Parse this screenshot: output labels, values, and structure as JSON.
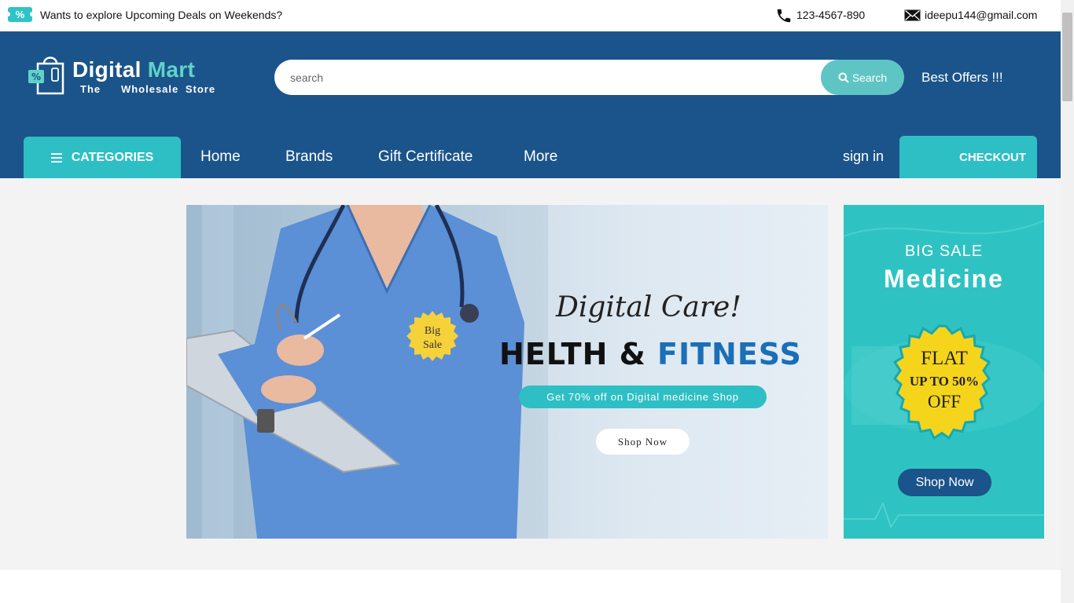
{
  "topbar": {
    "promo_icon": "percent-ticket-icon",
    "promo_icon_glyph": "%",
    "promo_text": "Wants to explore Upcoming Deals on Weekends?",
    "phone": "123-4567-890",
    "email": "ideepu144@gmail.com"
  },
  "header": {
    "logo": {
      "name_part1": "Digital",
      "name_part2": "Mart",
      "tagline": "The   Wholesale Store"
    },
    "search": {
      "placeholder": "search",
      "button_label": "Search"
    },
    "offers_label": "Best Offers !!!",
    "categories_label": "CATEGORIES",
    "nav": [
      "Home",
      "Brands",
      "Gift Certificate",
      "More"
    ],
    "signin_label": "sign in",
    "checkout_label": "CHECKOUT",
    "colors": {
      "header_bg": "#1b548a",
      "accent": "#2ebfc4"
    }
  },
  "hero": {
    "badge_line1": "Big",
    "badge_line2": "Sale",
    "script_title": "Digital Care!",
    "headline_part1": "HELTH & ",
    "headline_part2": "FITNESS",
    "offer": "Get 70% off on Digital medicine Shop",
    "button_label": "Shop Now"
  },
  "side_banner": {
    "big_sale": "BIG SALE",
    "title": "Medicine",
    "flat_line1": "FLAT",
    "flat_line2": "UP TO 50%",
    "flat_line3": "OFF",
    "button_label": "Shop Now"
  }
}
